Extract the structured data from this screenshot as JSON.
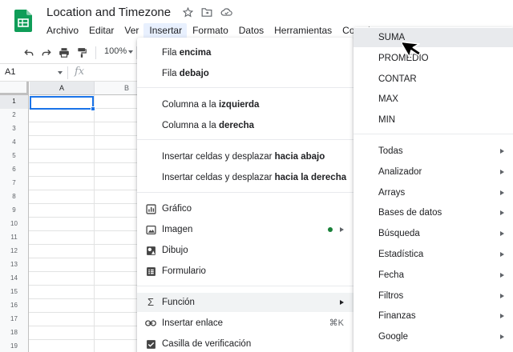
{
  "doc": {
    "title": "Location and Timezone",
    "icons": [
      "star-icon",
      "move-to-folder-icon",
      "cloud-status-icon"
    ]
  },
  "menubar": {
    "items": [
      "Archivo",
      "Editar",
      "Ver",
      "Insertar",
      "Formato",
      "Datos",
      "Herramientas",
      "Comple"
    ],
    "active": "Insertar"
  },
  "toolbar": {
    "icons": [
      "undo-icon",
      "redo-icon",
      "print-icon",
      "paint-format-icon"
    ],
    "zoom": "100%"
  },
  "formula_bar": {
    "namebox": "A1",
    "fx": "fx"
  },
  "grid": {
    "columns": [
      "A",
      "B"
    ],
    "rows": [
      "1",
      "2",
      "3",
      "4",
      "5",
      "6",
      "7",
      "8",
      "9",
      "10",
      "11",
      "12",
      "13",
      "14",
      "15",
      "16",
      "17",
      "18",
      "19"
    ],
    "selected_cell": "A1"
  },
  "insert_menu": {
    "items": [
      {
        "pre": "Fila ",
        "bold": "encima"
      },
      {
        "pre": "Fila ",
        "bold": "debajo"
      },
      {
        "pre": "Columna a la ",
        "bold": "izquierda"
      },
      {
        "pre": "Columna a la ",
        "bold": "derecha"
      },
      {
        "pre": "Insertar celdas y desplazar ",
        "bold": "hacia abajo"
      },
      {
        "pre": "Insertar celdas y desplazar ",
        "bold": "hacia la derecha"
      }
    ],
    "objects": [
      {
        "label": "Gráfico",
        "icon": "chart-icon"
      },
      {
        "label": "Imagen",
        "icon": "image-icon"
      },
      {
        "label": "Dibujo",
        "icon": "drawing-icon"
      },
      {
        "label": "Formulario",
        "icon": "form-icon"
      }
    ],
    "function": {
      "label": "Función",
      "icon": "sigma-icon"
    },
    "link": {
      "label": "Insertar enlace",
      "icon": "link-icon",
      "shortcut": "⌘K"
    },
    "checkbox": {
      "label": "Casilla de verificación",
      "icon": "checkbox-icon"
    }
  },
  "function_menu": {
    "quick": [
      "SUMA",
      "PROMEDIO",
      "CONTAR",
      "MAX",
      "MIN"
    ],
    "categories": [
      "Todas",
      "Analizador",
      "Arrays",
      "Bases de datos",
      "Búsqueda",
      "Estadística",
      "Fecha",
      "Filtros",
      "Finanzas",
      "Google"
    ],
    "hovered": "SUMA"
  },
  "colors": {
    "sheets_green": "#0f9d58",
    "selection_blue": "#1a73e8",
    "menu_active_bg": "#e8f0fe",
    "new_badge_green": "#188038"
  }
}
